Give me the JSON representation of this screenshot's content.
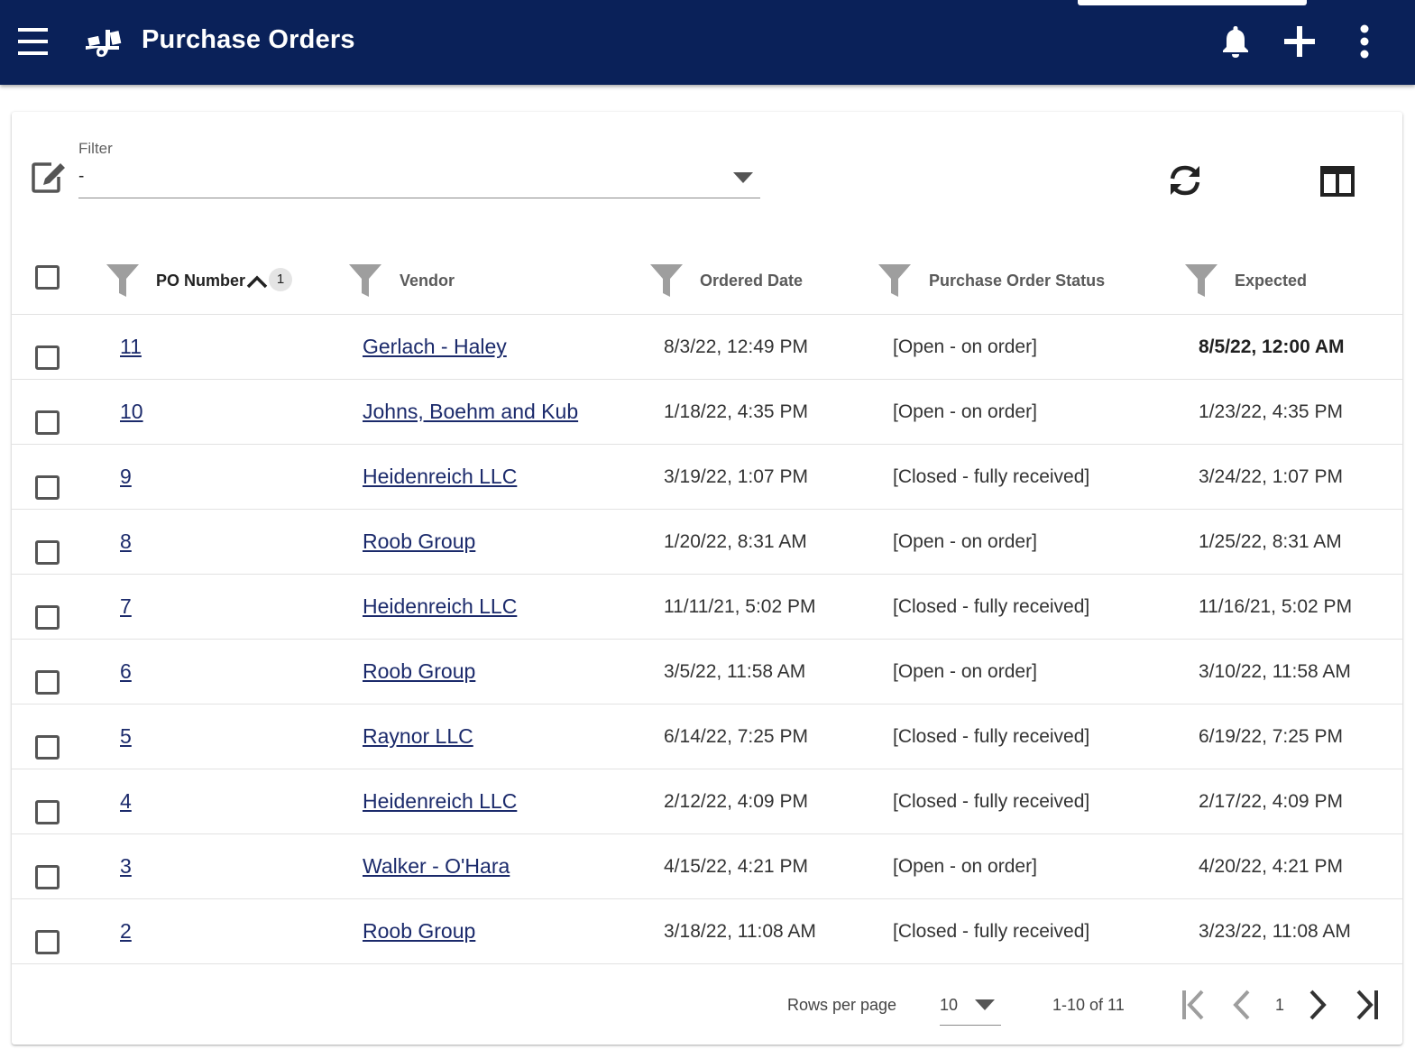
{
  "appbar": {
    "title": "Purchase Orders",
    "icons": [
      "menu-icon",
      "hand-truck-icon",
      "bell-icon",
      "plus-icon",
      "more-vertical-icon"
    ],
    "color": "#0a2159"
  },
  "filter": {
    "label": "Filter",
    "value": "-"
  },
  "table": {
    "headers": {
      "po_number": "PO Number",
      "sort_badge": "1",
      "vendor": "Vendor",
      "ordered_date": "Ordered Date",
      "status": "Purchase Order Status",
      "expected": "Expected"
    },
    "rows": [
      {
        "po": "11",
        "vendor": "Gerlach - Haley",
        "ordered": "8/3/22, 12:49 PM",
        "status": "[Open - on order]",
        "expected": "8/5/22, 12:00 AM"
      },
      {
        "po": "10",
        "vendor": "Johns, Boehm and Kub",
        "ordered": "1/18/22, 4:35 PM",
        "status": "[Open - on order]",
        "expected": "1/23/22, 4:35 PM"
      },
      {
        "po": "9",
        "vendor": "Heidenreich LLC",
        "ordered": "3/19/22, 1:07 PM",
        "status": "[Closed - fully received]",
        "expected": "3/24/22, 1:07 PM"
      },
      {
        "po": "8",
        "vendor": "Roob Group",
        "ordered": "1/20/22, 8:31 AM",
        "status": "[Open - on order]",
        "expected": "1/25/22, 8:31 AM"
      },
      {
        "po": "7",
        "vendor": "Heidenreich LLC",
        "ordered": "11/11/21, 5:02 PM",
        "status": "[Closed - fully received]",
        "expected": "11/16/21, 5:02 PM"
      },
      {
        "po": "6",
        "vendor": "Roob Group",
        "ordered": "3/5/22, 11:58 AM",
        "status": "[Open - on order]",
        "expected": "3/10/22, 11:58 AM"
      },
      {
        "po": "5",
        "vendor": "Raynor LLC",
        "ordered": "6/14/22, 7:25 PM",
        "status": "[Closed - fully received]",
        "expected": "6/19/22, 7:25 PM"
      },
      {
        "po": "4",
        "vendor": "Heidenreich LLC",
        "ordered": "2/12/22, 4:09 PM",
        "status": "[Closed - fully received]",
        "expected": "2/17/22, 4:09 PM"
      },
      {
        "po": "3",
        "vendor": "Walker - O'Hara",
        "ordered": "4/15/22, 4:21 PM",
        "status": "[Open - on order]",
        "expected": "4/20/22, 4:21 PM"
      },
      {
        "po": "2",
        "vendor": "Roob Group",
        "ordered": "3/18/22, 11:08 AM",
        "status": "[Closed - fully received]",
        "expected": "3/23/22, 11:08 AM"
      }
    ]
  },
  "pagination": {
    "rows_per_page_label": "Rows per page",
    "rows_per_page_value": "10",
    "range": "1-10 of 11",
    "page": "1"
  }
}
